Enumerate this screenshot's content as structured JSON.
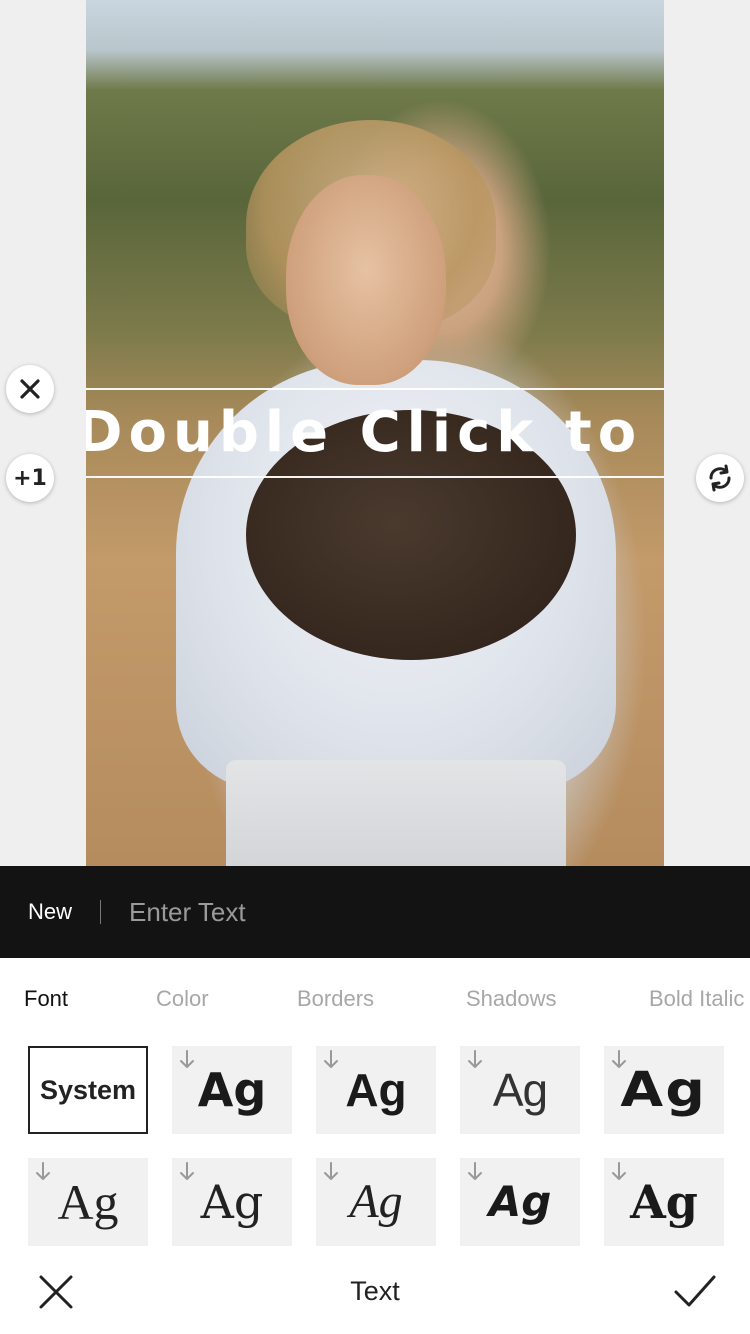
{
  "canvas": {
    "overlay_text": "Double Click to Edit",
    "duplicate_label": "+1"
  },
  "input_bar": {
    "new_label": "New",
    "placeholder": "Enter Text"
  },
  "tabs": [
    {
      "label": "Font",
      "active": true
    },
    {
      "label": "Color",
      "active": false
    },
    {
      "label": "Borders",
      "active": false
    },
    {
      "label": "Shadows",
      "active": false
    },
    {
      "label": "Bold Italic",
      "active": false
    }
  ],
  "fonts": [
    {
      "label": "System",
      "selected": true,
      "downloadable": false
    },
    {
      "label": "Ag",
      "selected": false,
      "downloadable": true
    },
    {
      "label": "Ag",
      "selected": false,
      "downloadable": true
    },
    {
      "label": "Ag",
      "selected": false,
      "downloadable": true
    },
    {
      "label": "Ag",
      "selected": false,
      "downloadable": true
    },
    {
      "label": "Ag",
      "selected": false,
      "downloadable": true
    },
    {
      "label": "Ag",
      "selected": false,
      "downloadable": true
    },
    {
      "label": "Ag",
      "selected": false,
      "downloadable": true
    },
    {
      "label": "Ag",
      "selected": false,
      "downloadable": true
    },
    {
      "label": "Ag",
      "selected": false,
      "downloadable": true
    }
  ],
  "bottom_bar": {
    "title": "Text",
    "cancel_icon": "close-icon",
    "confirm_icon": "checkmark-icon"
  },
  "colors": {
    "input_bar_bg": "#131313",
    "canvas_bg": "#efefef",
    "tile_bg": "#f1f1f1"
  }
}
